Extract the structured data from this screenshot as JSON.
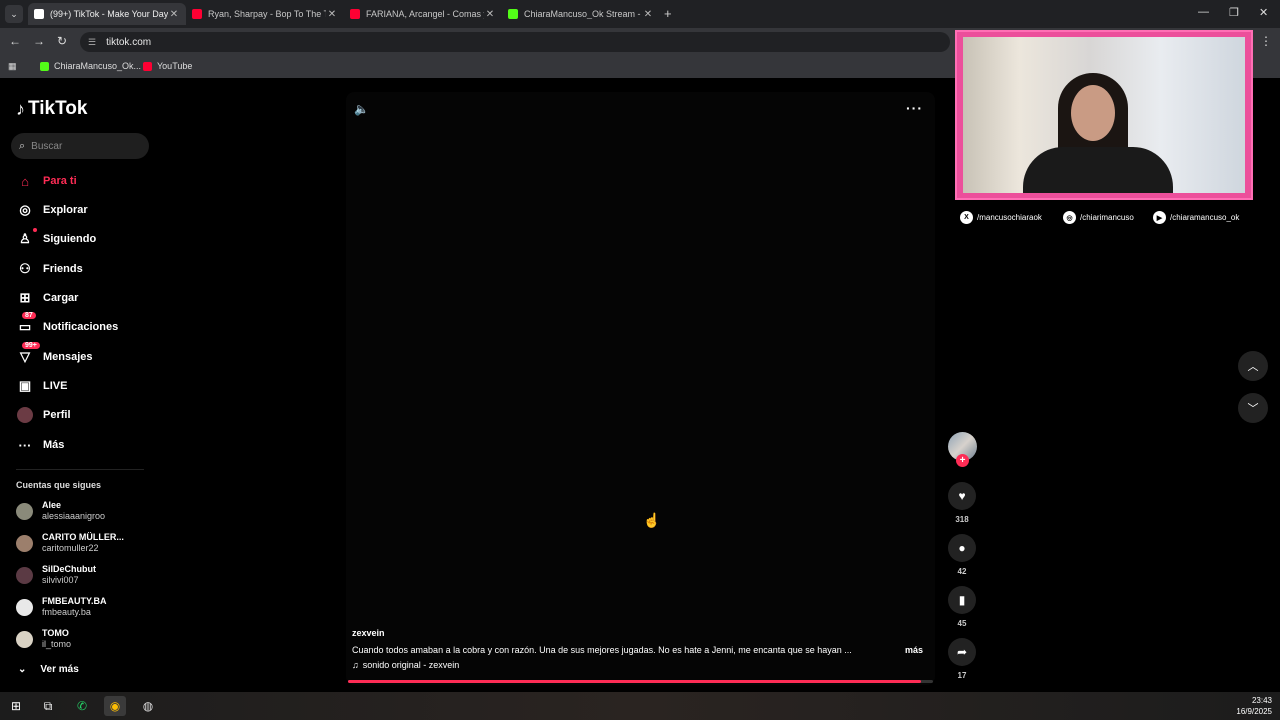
{
  "browser": {
    "tabs": [
      {
        "title": "(99+) TikTok - Make Your Day",
        "favicon_color": "#ffffff",
        "active": true
      },
      {
        "title": "Ryan, Sharpay - Bop To The Top",
        "favicon_color": "#ff0033",
        "active": false
      },
      {
        "title": "FARIANA, Arcangel - Comas y C",
        "favicon_color": "#ff0033",
        "active": false
      },
      {
        "title": "ChiaraMancuso_Ok Stream - W",
        "favicon_color": "#53fc18",
        "active": false
      }
    ],
    "address": "tiktok.com",
    "bookmarks": [
      {
        "label": "ChiaraMancuso_Ok...",
        "favicon_color": "#53fc18"
      },
      {
        "label": "YouTube",
        "favicon_color": "#ff0033"
      }
    ]
  },
  "sidebar": {
    "logo": "TikTok",
    "search_placeholder": "Buscar",
    "nav": [
      {
        "label": "Para ti",
        "icon": "home-icon",
        "active": true
      },
      {
        "label": "Explorar",
        "icon": "compass-icon"
      },
      {
        "label": "Siguiendo",
        "icon": "following-icon"
      },
      {
        "label": "Friends",
        "icon": "friends-icon"
      },
      {
        "label": "Cargar",
        "icon": "upload-icon"
      },
      {
        "label": "Notificaciones",
        "icon": "inbox-icon",
        "badge": "87"
      },
      {
        "label": "Mensajes",
        "icon": "messages-icon",
        "badge": "99+"
      },
      {
        "label": "LIVE",
        "icon": "live-icon"
      },
      {
        "label": "Perfil",
        "icon": "profile-avatar"
      },
      {
        "label": "Más",
        "icon": "more-icon"
      }
    ],
    "following_heading": "Cuentas que sigues",
    "accounts": [
      {
        "name": "Alee",
        "handle": "alessiaaanigroo",
        "avatar_color": "#8a8a7a"
      },
      {
        "name": "CARITO MÜLLER...",
        "handle": "caritomuller22",
        "avatar_color": "#9c7f6c"
      },
      {
        "name": "SilDeChubut",
        "handle": "silvivi007",
        "avatar_color": "#5b3a44"
      },
      {
        "name": "FMBEAUTY.BA",
        "handle": "fmbeauty.ba",
        "avatar_color": "#e8e8e8"
      },
      {
        "name": "TOMO",
        "handle": "il_tomo",
        "avatar_color": "#d9d2c4"
      }
    ],
    "see_more": "Ver más"
  },
  "video": {
    "author": "zexvein",
    "description": "Cuando todos amaban a la cobra y con razón. Una de sus mejores jugadas. No es hate a Jenni, me encanta que se hayan ...",
    "more_link": "más",
    "music": "sonido original - zexvein",
    "progress": 0.98
  },
  "actions": {
    "likes": "318",
    "comments": "42",
    "saves": "45",
    "shares": "17"
  },
  "overlay": {
    "socials": [
      {
        "icon": "x-icon",
        "glyph": "X",
        "handle": "/mancusochiaraok"
      },
      {
        "icon": "instagram-icon",
        "glyph": "◎",
        "handle": "/chiarimancuso"
      },
      {
        "icon": "youtube-icon",
        "glyph": "▶",
        "handle": "/chiaramancuso_ok"
      }
    ]
  },
  "taskbar": {
    "time": "23:43",
    "date": "16/9/2025"
  },
  "colors": {
    "accent": "#fe2c55",
    "overlay_pink": "#ec4f9b"
  }
}
